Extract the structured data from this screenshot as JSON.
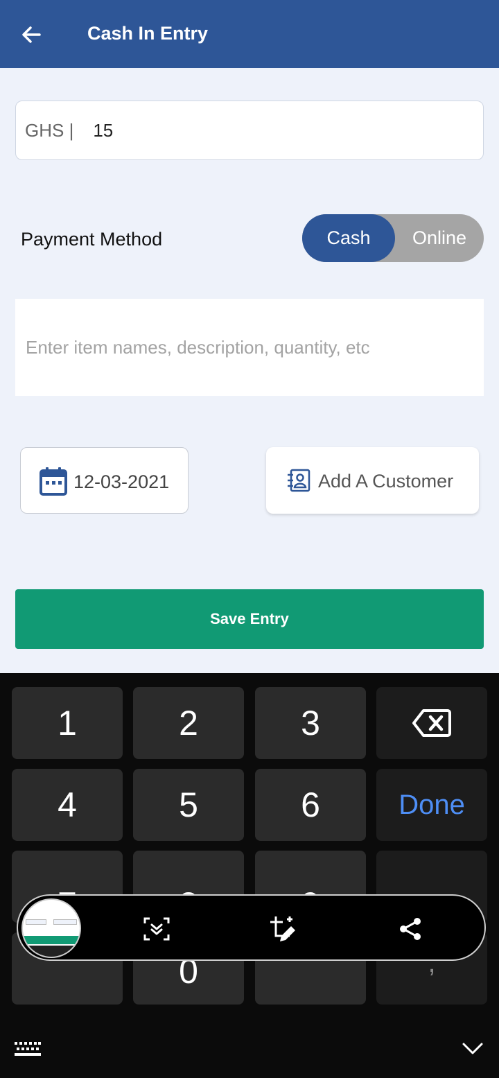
{
  "header": {
    "title": "Cash In Entry",
    "back_icon": "arrow-left-icon"
  },
  "amount": {
    "currency": "GHS |",
    "value": "15"
  },
  "payment": {
    "label": "Payment Method",
    "options": [
      "Cash",
      "Online"
    ],
    "selected": "Cash"
  },
  "description": {
    "placeholder": "Enter item names,  description, quantity, etc"
  },
  "date": {
    "value": "12-03-2021",
    "icon": "calendar-icon"
  },
  "customer": {
    "label": "Add A Customer",
    "icon": "contact-book-icon"
  },
  "save": {
    "label": "Save Entry"
  },
  "keyboard": {
    "keys": [
      "1",
      "2",
      "3",
      "4",
      "5",
      "6",
      "7",
      "8",
      "9",
      "-",
      "0",
      ","
    ],
    "done_label": "Done",
    "backspace_icon": "backspace-icon",
    "keyboard_switch_icon": "keyboard-icon",
    "hide_icon": "chevron-down-icon"
  },
  "screenshot_toolbar": {
    "icons": [
      "scroll-capture-icon",
      "crop-edit-icon",
      "share-icon"
    ]
  },
  "colors": {
    "primary": "#2e5697",
    "save": "#119a74",
    "done": "#4e8ef5"
  }
}
